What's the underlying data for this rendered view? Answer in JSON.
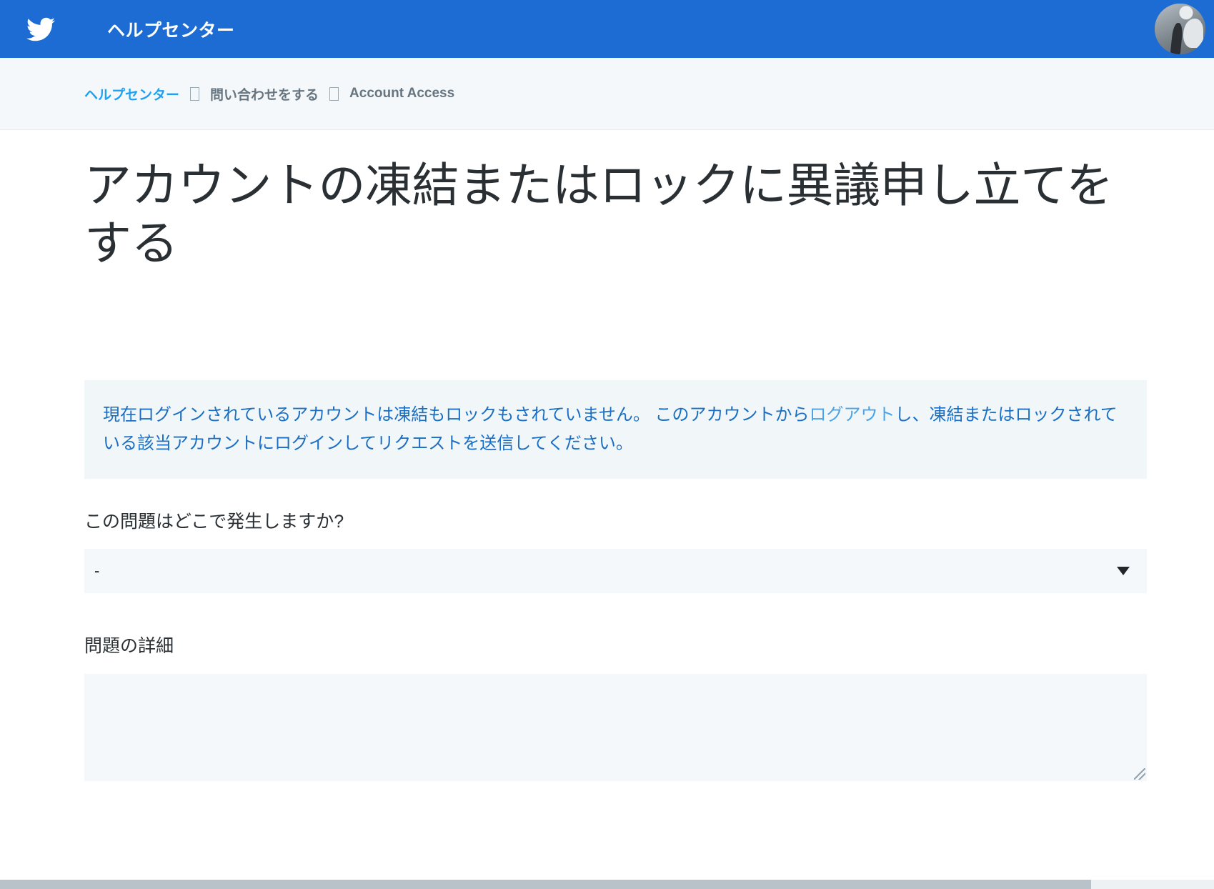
{
  "header": {
    "logo_icon": "twitter-bird-icon",
    "title": "ヘルプセンター",
    "brand_color": "#1c6cd4",
    "avatar_icon": "user-avatar",
    "avatar_overlay_glyph": ""
  },
  "breadcrumb": {
    "items": [
      {
        "label": "ヘルプセンター",
        "type": "link"
      },
      {
        "label": "問い合わせをする",
        "type": "static"
      },
      {
        "label": "Account Access",
        "type": "static"
      }
    ],
    "separator_glyph": "",
    "link_color": "#1da1f2",
    "static_color": "#66757f"
  },
  "main": {
    "page_title": "アカウントの凍結またはロックに異議申し立てをする",
    "notice": {
      "text_before": "現在ログインされているアカウントは凍結もロックもされていません。 このアカウントから",
      "link_text": "ログアウト",
      "text_after": "し、凍結またはロックされている該当アカウントにログインしてリクエストを送信してください。",
      "background": "#f1f6f9",
      "text_color": "#1a6fc4",
      "link_color": "#4aa3e8"
    },
    "fields": [
      {
        "label": "この問題はどこで発生しますか?",
        "type": "select",
        "value": "-",
        "arrow_icon": "chevron-down-icon"
      },
      {
        "label": "問題の詳細",
        "type": "textarea",
        "value": "",
        "placeholder": ""
      }
    ]
  }
}
